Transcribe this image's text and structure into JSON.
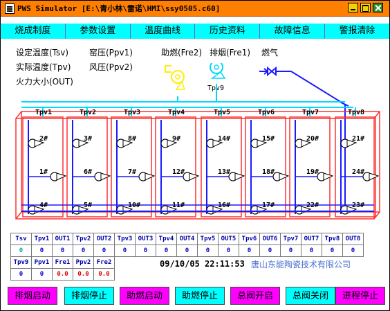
{
  "window": {
    "title": "PWS Simulator  [E:\\青小林\\雷诺\\HMI\\ssy0505.c60]"
  },
  "menu": [
    "烧成制度",
    "参数设置",
    "温度曲线",
    "历史资料",
    "故障信息",
    "警报清除"
  ],
  "legend": {
    "set_temp": "设定温度(Tsv)",
    "kiln_pressure": "窑压(Ppv1)",
    "actual_temp": "实际温度(Tpv)",
    "wind_pressure": "风压(Ppv2)",
    "fire_size": "火力大小(OUT)",
    "combustion_fan": "助燃(Fre2)",
    "exhaust_fan": "排烟(Fre1)",
    "gas": "燃气"
  },
  "diagram": {
    "tpv9": "Tpv9",
    "zones": [
      "Tpv1",
      "Tpv2",
      "Tpv3",
      "Tpv4",
      "Tpv5",
      "Tpv6",
      "Tpv7",
      "Tpv8"
    ],
    "burners": [
      "1#",
      "2#",
      "3#",
      "4#",
      "5#",
      "6#",
      "7#",
      "8#",
      "9#",
      "10#",
      "11#",
      "12#",
      "13#",
      "14#",
      "15#",
      "16#",
      "17#",
      "18#",
      "19#",
      "20#",
      "21#",
      "22#",
      "23#",
      "24#"
    ]
  },
  "table": {
    "row1_headers": [
      "Tsv",
      "Tpv1",
      "OUT1",
      "Tpv2",
      "OUT2",
      "Tpv3",
      "OUT3",
      "Tpv4",
      "OUT4",
      "Tpv5",
      "OUT5",
      "Tpv6",
      "OUT6",
      "Tpv7",
      "OUT7",
      "Tpv8",
      "OUT8"
    ],
    "row1_values": [
      "0",
      "0",
      "0",
      "0",
      "0",
      "0",
      "0",
      "0",
      "0",
      "0",
      "0",
      "0",
      "0",
      "0",
      "0",
      "0",
      "0"
    ],
    "row2_headers": [
      "Tpv9",
      "Ppv1",
      "Fre1",
      "Ppv2",
      "Fre2"
    ],
    "row2_values": [
      "0",
      "0",
      "0.0",
      "0.0",
      "0.0"
    ]
  },
  "datetime": "09/10/05 22:11:53",
  "company": "唐山东能陶瓷技术有限公司",
  "buttons": [
    "排烟启动",
    "排烟停止",
    "助燃启动",
    "助燃停止",
    "总阀开启",
    "总阀关闭",
    "进程停止"
  ],
  "colors": {
    "titlebar": "#ff7f00",
    "menubar": "#00ffff",
    "kiln_outline": "#ff3030",
    "gas_pipe": "#1a1aff",
    "air_pipe": "#00d8ff",
    "fan": "#ffee00",
    "button_magenta": "#ff00ff",
    "button_cyan": "#00ffff"
  }
}
